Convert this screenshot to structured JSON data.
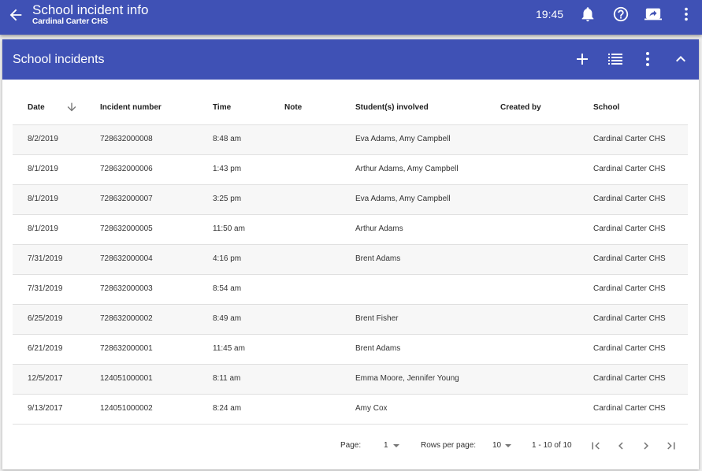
{
  "appbar": {
    "title": "School incident info",
    "subtitle": "Cardinal Carter CHS",
    "clock": "19:45",
    "icons": [
      "back-arrow-icon",
      "bell-icon",
      "help-icon",
      "screen-share-icon",
      "more-vert-icon"
    ]
  },
  "card": {
    "title": "School incidents",
    "icons": [
      "add-icon",
      "list-view-icon",
      "more-vert-icon",
      "chevron-up-icon"
    ]
  },
  "table": {
    "columns": [
      "Date",
      "Incident number",
      "Time",
      "Note",
      "Student(s) involved",
      "Created by",
      "School"
    ],
    "sort_column": "Date",
    "sort_direction": "descending",
    "rows": [
      {
        "date": "8/2/2019",
        "number": "728632000008",
        "time": "8:48 am",
        "note": "",
        "students": "Eva Adams, Amy Campbell",
        "created_by": "",
        "school": "Cardinal Carter CHS"
      },
      {
        "date": "8/1/2019",
        "number": "728632000006",
        "time": "1:43 pm",
        "note": "",
        "students": "Arthur Adams, Amy Campbell",
        "created_by": "",
        "school": "Cardinal Carter CHS"
      },
      {
        "date": "8/1/2019",
        "number": "728632000007",
        "time": "3:25 pm",
        "note": "",
        "students": "Eva Adams, Amy Campbell",
        "created_by": "",
        "school": "Cardinal Carter CHS"
      },
      {
        "date": "8/1/2019",
        "number": "728632000005",
        "time": "11:50 am",
        "note": "",
        "students": "Arthur Adams",
        "created_by": "",
        "school": "Cardinal Carter CHS"
      },
      {
        "date": "7/31/2019",
        "number": "728632000004",
        "time": "4:16 pm",
        "note": "",
        "students": "Brent Adams",
        "created_by": "",
        "school": "Cardinal Carter CHS"
      },
      {
        "date": "7/31/2019",
        "number": "728632000003",
        "time": "8:54 am",
        "note": "",
        "students": "",
        "created_by": "",
        "school": "Cardinal Carter CHS"
      },
      {
        "date": "6/25/2019",
        "number": "728632000002",
        "time": "8:49 am",
        "note": "",
        "students": "Brent Fisher",
        "created_by": "",
        "school": "Cardinal Carter CHS"
      },
      {
        "date": "6/21/2019",
        "number": "728632000001",
        "time": "11:45 am",
        "note": "",
        "students": "Brent Adams",
        "created_by": "",
        "school": "Cardinal Carter CHS"
      },
      {
        "date": "12/5/2017",
        "number": "124051000001",
        "time": "8:11 am",
        "note": "",
        "students": "Emma Moore, Jennifer Young",
        "created_by": "",
        "school": "Cardinal Carter CHS"
      },
      {
        "date": "9/13/2017",
        "number": "124051000002",
        "time": "8:24 am",
        "note": "",
        "students": "Amy Cox",
        "created_by": "",
        "school": "Cardinal Carter CHS"
      }
    ]
  },
  "pager": {
    "page_label": "Page:",
    "page_value": "1",
    "rows_label": "Rows per page:",
    "rows_value": "10",
    "range": "1 - 10 of 10",
    "icons": [
      "first-page-icon",
      "prev-page-icon",
      "next-page-icon",
      "last-page-icon"
    ]
  },
  "colors": {
    "primary": "#3f51b5",
    "background": "#ececec",
    "row_stripe": "#f7f7f7"
  }
}
